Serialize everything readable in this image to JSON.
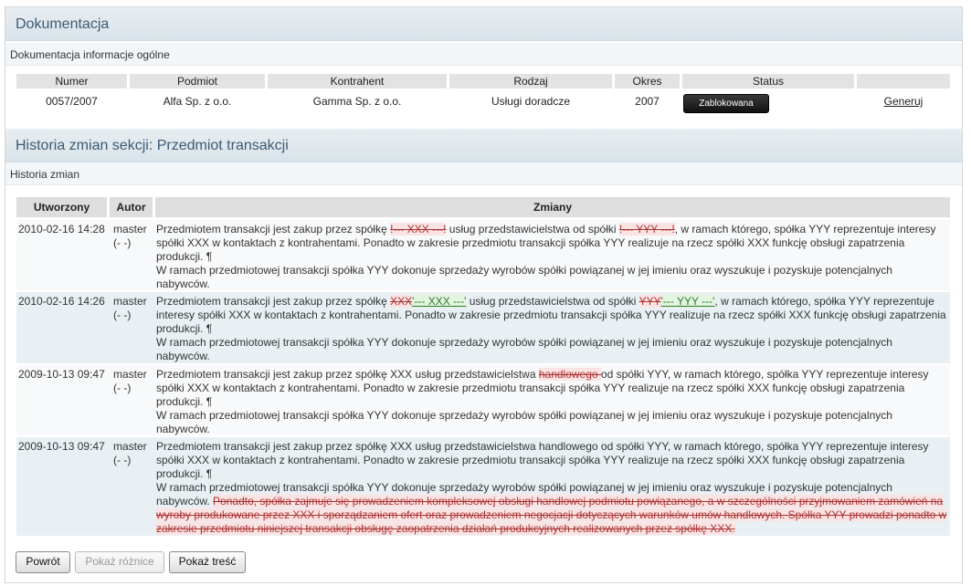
{
  "doc_section": {
    "title": "Dokumentacja",
    "subtitle": "Dokumentacja informacje ogólne",
    "columns": [
      "Numer",
      "Podmiot",
      "Kontrahent",
      "Rodzaj",
      "Okres",
      "Status"
    ],
    "row": {
      "numer": "0057/2007",
      "podmiot": "Alfa Sp. z o.o.",
      "kontrahent": "Gamma Sp. z o.o.",
      "rodzaj": "Usługi doradcze",
      "okres": "2007",
      "status": "Zablokowana",
      "action": "Generuj"
    }
  },
  "history_section": {
    "title": "Historia zmian sekcji: Przedmiot transakcji",
    "subtitle": "Historia zmian",
    "columns": [
      "Utworzony",
      "Autor",
      "Zmiany"
    ],
    "rows": [
      {
        "date": "2010-02-16 14:28",
        "author": "master",
        "author_sub": "(- -)",
        "p1_a": "Przedmiotem transakcji jest zakup przez spółkę ",
        "p1_b": "!--- XXX ---!",
        "p1_c": " usług przedstawicielstwa od spółki ",
        "p1_d": "!--- YYY ---!",
        "p1_e": ", w ramach którego, spółka YYY reprezentuje interesy spółki XXX w kontaktach z kontrahentami. Ponadto w zakresie przedmiotu transakcji spółka YYY realizuje na rzecz spółki XXX funkcję obsługi zapatrzenia produkcji. ¶",
        "p2": "W ramach przedmiotowej transakcji spółka YYY dokonuje sprzedaży wyrobów spółki powiązanej w jej imieniu oraz wyszukuje i pozyskuje potencjalnych nabywców."
      },
      {
        "date": "2010-02-16 14:26",
        "author": "master",
        "author_sub": "(- -)",
        "p1_a": "Przedmiotem transakcji jest zakup przez spółkę ",
        "p1_del1": "XXX",
        "p1_ins1": "'--- XXX ---'",
        "p1_b": " usług przedstawicielstwa od spółki ",
        "p1_del2": "YYY",
        "p1_ins2": "'--- YYY ---'",
        "p1_c": ", w ramach którego, spółka YYY reprezentuje interesy spółki XXX w kontaktach z kontrahentami. Ponadto w zakresie przedmiotu transakcji spółka YYY realizuje na rzecz spółki XXX funkcję obsługi zapatrzenia produkcji. ¶",
        "p2": "W ramach przedmiotowej transakcji spółka YYY dokonuje sprzedaży wyrobów spółki powiązanej w jej imieniu oraz wyszukuje i pozyskuje potencjalnych nabywców."
      },
      {
        "date": "2009-10-13 09:47",
        "author": "master",
        "author_sub": "(- -)",
        "p1_a": "Przedmiotem transakcji jest zakup przez spółkę XXX usług przedstawicielstwa ",
        "p1_del": "handlowego ",
        "p1_b": "od spółki YYY, w ramach którego, spółka YYY reprezentuje interesy spółki XXX w kontaktach z kontrahentami. Ponadto w zakresie przedmiotu transakcji spółka YYY realizuje na rzecz spółki XXX funkcję obsługi zapatrzenia produkcji. ¶",
        "p2": "W ramach przedmiotowej transakcji spółka YYY dokonuje sprzedaży wyrobów spółki powiązanej w jej imieniu oraz wyszukuje i pozyskuje potencjalnych nabywców."
      },
      {
        "date": "2009-10-13 09:47",
        "author": "master",
        "author_sub": "(- -)",
        "p1": "Przedmiotem transakcji jest zakup przez spółkę XXX usług przedstawicielstwa handlowego od spółki YYY, w ramach którego, spółka YYY reprezentuje interesy spółki XXX w kontaktach z kontrahentami. Ponadto w zakresie przedmiotu transakcji spółka YYY realizuje na rzecz spółki XXX funkcję obsługi zapatrzenia produkcji. ¶",
        "p2_a": "W ramach przedmiotowej transakcji spółka YYY dokonuje sprzedaży wyrobów spółki powiązanej w jej imieniu oraz wyszukuje i pozyskuje potencjalnych nabywców. ",
        "p2_del": "Ponadto, spółka zajmuje się prowadzeniem kompleksowej obsługi handlowej podmiotu powiązanego, a w szczególności przyjmowaniem zamówień na wyroby produkowane przez XXX i sporządzaniem ofert oraz prowadzeniem negocjacji dotyczących warunków umów handlowych. Spółka YYY prowadzi ponadto w zakresie przedmiotu niniejszej transakcji obsługę zaopatrzenia działań produkcyjnych realizowanych przez spółkę XXX."
      }
    ]
  },
  "buttons": {
    "back": "Powrót",
    "show_diff": "Pokaż różnice",
    "show_content": "Pokaż treść"
  }
}
